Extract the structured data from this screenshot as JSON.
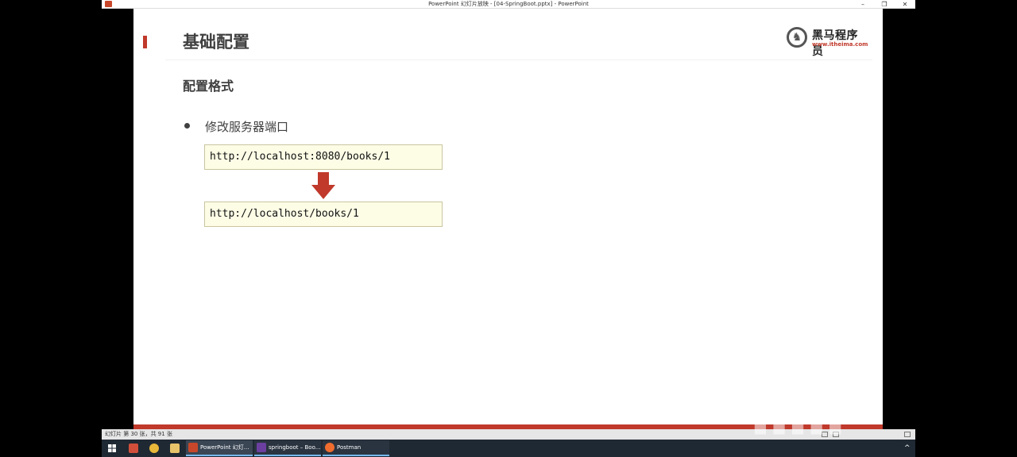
{
  "window": {
    "title": "PowerPoint 幻灯片放映 - [04-SpringBoot.pptx] - PowerPoint",
    "min_label": "–",
    "max_label": "❐",
    "close_label": "✕"
  },
  "slide": {
    "title": "基础配置",
    "subtitle": "配置格式",
    "bullet": "修改服务器端口",
    "url_before": "http://localhost:8080/books/1",
    "url_after": "http://localhost/books/1",
    "logo": {
      "name": "黑马程序员",
      "url": "www.itheima.com"
    }
  },
  "status": {
    "text": "幻灯片 第 30 张，共 91 张"
  },
  "taskbar": {
    "items": [
      {
        "label": "PowerPoint 幻灯..."
      },
      {
        "label": "springboot – Boo..."
      },
      {
        "label": "Postman"
      }
    ]
  },
  "colors": {
    "accent": "#c0392b",
    "url_box_bg": "#fdfde6",
    "taskbar_bg": "#1f2933"
  },
  "icons": [
    "powerpoint-icon",
    "windows-start-icon",
    "chrome-icon",
    "file-explorer-icon",
    "intellij-icon",
    "postman-icon",
    "arrow-down-icon",
    "itheima-logo-icon"
  ]
}
